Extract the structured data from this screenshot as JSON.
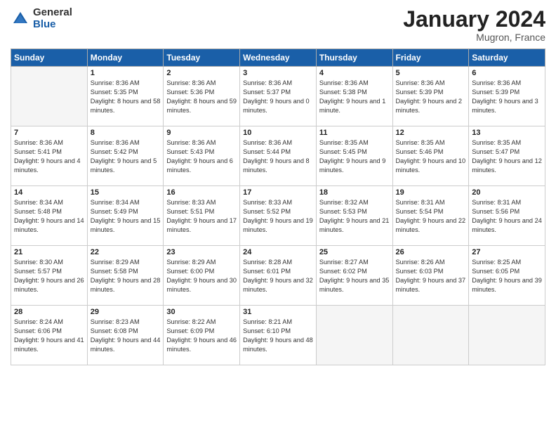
{
  "logo": {
    "general": "General",
    "blue": "Blue"
  },
  "header": {
    "month": "January 2024",
    "location": "Mugron, France"
  },
  "weekdays": [
    "Sunday",
    "Monday",
    "Tuesday",
    "Wednesday",
    "Thursday",
    "Friday",
    "Saturday"
  ],
  "weeks": [
    [
      {
        "day": "",
        "empty": true
      },
      {
        "day": "1",
        "sunrise": "Sunrise: 8:36 AM",
        "sunset": "Sunset: 5:35 PM",
        "daylight": "Daylight: 8 hours and 58 minutes."
      },
      {
        "day": "2",
        "sunrise": "Sunrise: 8:36 AM",
        "sunset": "Sunset: 5:36 PM",
        "daylight": "Daylight: 8 hours and 59 minutes."
      },
      {
        "day": "3",
        "sunrise": "Sunrise: 8:36 AM",
        "sunset": "Sunset: 5:37 PM",
        "daylight": "Daylight: 9 hours and 0 minutes."
      },
      {
        "day": "4",
        "sunrise": "Sunrise: 8:36 AM",
        "sunset": "Sunset: 5:38 PM",
        "daylight": "Daylight: 9 hours and 1 minute."
      },
      {
        "day": "5",
        "sunrise": "Sunrise: 8:36 AM",
        "sunset": "Sunset: 5:39 PM",
        "daylight": "Daylight: 9 hours and 2 minutes."
      },
      {
        "day": "6",
        "sunrise": "Sunrise: 8:36 AM",
        "sunset": "Sunset: 5:39 PM",
        "daylight": "Daylight: 9 hours and 3 minutes."
      }
    ],
    [
      {
        "day": "7",
        "sunrise": "Sunrise: 8:36 AM",
        "sunset": "Sunset: 5:41 PM",
        "daylight": "Daylight: 9 hours and 4 minutes."
      },
      {
        "day": "8",
        "sunrise": "Sunrise: 8:36 AM",
        "sunset": "Sunset: 5:42 PM",
        "daylight": "Daylight: 9 hours and 5 minutes."
      },
      {
        "day": "9",
        "sunrise": "Sunrise: 8:36 AM",
        "sunset": "Sunset: 5:43 PM",
        "daylight": "Daylight: 9 hours and 6 minutes."
      },
      {
        "day": "10",
        "sunrise": "Sunrise: 8:36 AM",
        "sunset": "Sunset: 5:44 PM",
        "daylight": "Daylight: 9 hours and 8 minutes."
      },
      {
        "day": "11",
        "sunrise": "Sunrise: 8:35 AM",
        "sunset": "Sunset: 5:45 PM",
        "daylight": "Daylight: 9 hours and 9 minutes."
      },
      {
        "day": "12",
        "sunrise": "Sunrise: 8:35 AM",
        "sunset": "Sunset: 5:46 PM",
        "daylight": "Daylight: 9 hours and 10 minutes."
      },
      {
        "day": "13",
        "sunrise": "Sunrise: 8:35 AM",
        "sunset": "Sunset: 5:47 PM",
        "daylight": "Daylight: 9 hours and 12 minutes."
      }
    ],
    [
      {
        "day": "14",
        "sunrise": "Sunrise: 8:34 AM",
        "sunset": "Sunset: 5:48 PM",
        "daylight": "Daylight: 9 hours and 14 minutes."
      },
      {
        "day": "15",
        "sunrise": "Sunrise: 8:34 AM",
        "sunset": "Sunset: 5:49 PM",
        "daylight": "Daylight: 9 hours and 15 minutes."
      },
      {
        "day": "16",
        "sunrise": "Sunrise: 8:33 AM",
        "sunset": "Sunset: 5:51 PM",
        "daylight": "Daylight: 9 hours and 17 minutes."
      },
      {
        "day": "17",
        "sunrise": "Sunrise: 8:33 AM",
        "sunset": "Sunset: 5:52 PM",
        "daylight": "Daylight: 9 hours and 19 minutes."
      },
      {
        "day": "18",
        "sunrise": "Sunrise: 8:32 AM",
        "sunset": "Sunset: 5:53 PM",
        "daylight": "Daylight: 9 hours and 21 minutes."
      },
      {
        "day": "19",
        "sunrise": "Sunrise: 8:31 AM",
        "sunset": "Sunset: 5:54 PM",
        "daylight": "Daylight: 9 hours and 22 minutes."
      },
      {
        "day": "20",
        "sunrise": "Sunrise: 8:31 AM",
        "sunset": "Sunset: 5:56 PM",
        "daylight": "Daylight: 9 hours and 24 minutes."
      }
    ],
    [
      {
        "day": "21",
        "sunrise": "Sunrise: 8:30 AM",
        "sunset": "Sunset: 5:57 PM",
        "daylight": "Daylight: 9 hours and 26 minutes."
      },
      {
        "day": "22",
        "sunrise": "Sunrise: 8:29 AM",
        "sunset": "Sunset: 5:58 PM",
        "daylight": "Daylight: 9 hours and 28 minutes."
      },
      {
        "day": "23",
        "sunrise": "Sunrise: 8:29 AM",
        "sunset": "Sunset: 6:00 PM",
        "daylight": "Daylight: 9 hours and 30 minutes."
      },
      {
        "day": "24",
        "sunrise": "Sunrise: 8:28 AM",
        "sunset": "Sunset: 6:01 PM",
        "daylight": "Daylight: 9 hours and 32 minutes."
      },
      {
        "day": "25",
        "sunrise": "Sunrise: 8:27 AM",
        "sunset": "Sunset: 6:02 PM",
        "daylight": "Daylight: 9 hours and 35 minutes."
      },
      {
        "day": "26",
        "sunrise": "Sunrise: 8:26 AM",
        "sunset": "Sunset: 6:03 PM",
        "daylight": "Daylight: 9 hours and 37 minutes."
      },
      {
        "day": "27",
        "sunrise": "Sunrise: 8:25 AM",
        "sunset": "Sunset: 6:05 PM",
        "daylight": "Daylight: 9 hours and 39 minutes."
      }
    ],
    [
      {
        "day": "28",
        "sunrise": "Sunrise: 8:24 AM",
        "sunset": "Sunset: 6:06 PM",
        "daylight": "Daylight: 9 hours and 41 minutes."
      },
      {
        "day": "29",
        "sunrise": "Sunrise: 8:23 AM",
        "sunset": "Sunset: 6:08 PM",
        "daylight": "Daylight: 9 hours and 44 minutes."
      },
      {
        "day": "30",
        "sunrise": "Sunrise: 8:22 AM",
        "sunset": "Sunset: 6:09 PM",
        "daylight": "Daylight: 9 hours and 46 minutes."
      },
      {
        "day": "31",
        "sunrise": "Sunrise: 8:21 AM",
        "sunset": "Sunset: 6:10 PM",
        "daylight": "Daylight: 9 hours and 48 minutes."
      },
      {
        "day": "",
        "empty": true
      },
      {
        "day": "",
        "empty": true
      },
      {
        "day": "",
        "empty": true
      }
    ]
  ]
}
